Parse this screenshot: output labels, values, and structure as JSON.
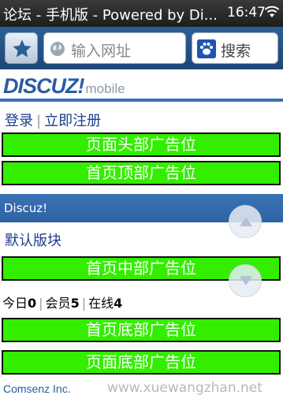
{
  "status": {
    "title": "论坛 - 手机版 - Powered by Di...",
    "time": "16:47"
  },
  "toolbar": {
    "url_placeholder": "输入网址",
    "search_label": "搜索"
  },
  "logo": {
    "brand": "DISCUZ!",
    "suffix": "mobile"
  },
  "auth": {
    "login": "登录",
    "register": "立即注册"
  },
  "ads": {
    "page_header": "页面头部广告位",
    "home_top": "首页顶部广告位",
    "home_middle": "首页中部广告位",
    "home_bottom": "首页底部广告位",
    "page_footer": "页面底部广告位"
  },
  "forum": {
    "section_title": "Discuz!",
    "board_name": "默认版块"
  },
  "stats": {
    "today_label": "今日",
    "today_value": "0",
    "members_label": "会员",
    "members_value": "5",
    "online_label": "在线",
    "online_value": "4"
  },
  "footer": {
    "company": "Comsenz Inc.",
    "watermark": "www.xuewangzhan.net"
  },
  "colors": {
    "ad_green": "#33ee00",
    "header_blue": "#3a72b5",
    "link_blue": "#1a3d8f"
  }
}
